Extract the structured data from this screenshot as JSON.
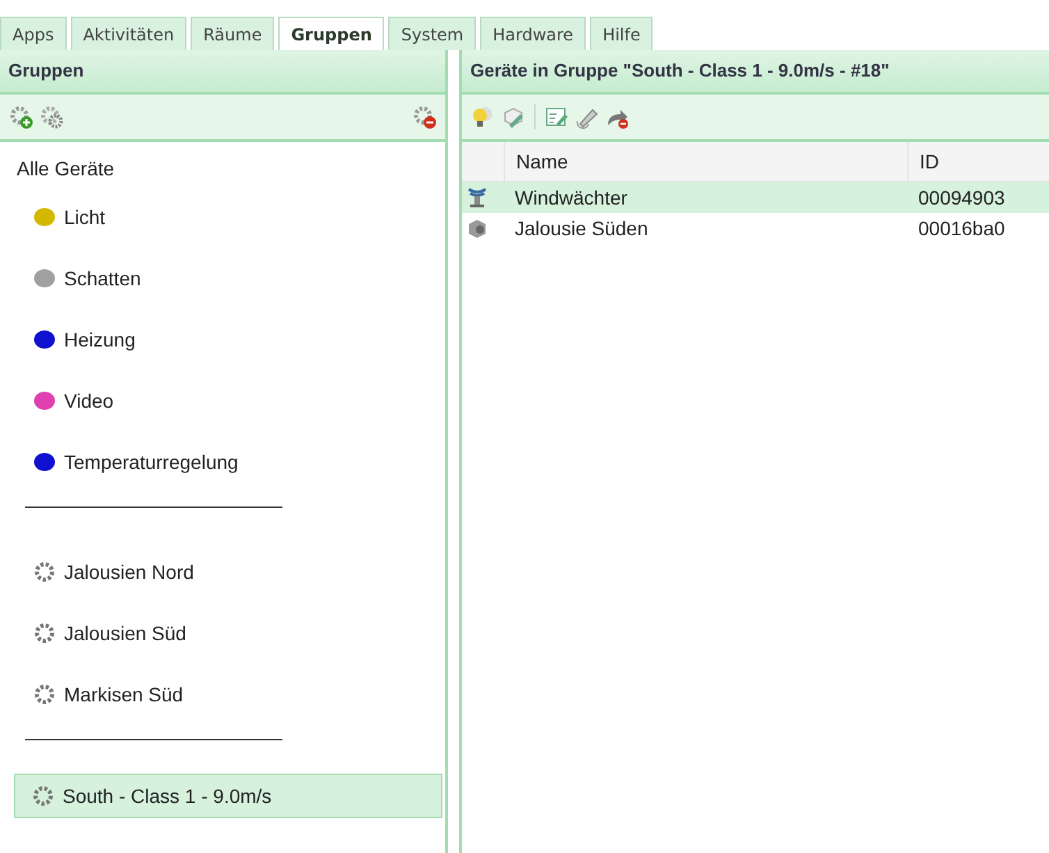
{
  "tabs": [
    {
      "label": "Apps",
      "selected": false
    },
    {
      "label": "Aktivitäten",
      "selected": false
    },
    {
      "label": "Räume",
      "selected": false
    },
    {
      "label": "Gruppen",
      "selected": true
    },
    {
      "label": "System",
      "selected": false
    },
    {
      "label": "Hardware",
      "selected": false
    },
    {
      "label": "Hilfe",
      "selected": false
    }
  ],
  "groups_panel": {
    "title": "Gruppen",
    "items": [
      {
        "kind": "all",
        "label": "Alle Geräte",
        "selected": false
      },
      {
        "kind": "color",
        "label": "Licht",
        "color": "#d4b800",
        "selected": false
      },
      {
        "kind": "color",
        "label": "Schatten",
        "color": "#a0a0a0",
        "selected": false
      },
      {
        "kind": "color",
        "label": "Heizung",
        "color": "#1010d0",
        "selected": false
      },
      {
        "kind": "color",
        "label": "Video",
        "color": "#e040b0",
        "selected": false
      },
      {
        "kind": "color",
        "label": "Temperaturregelung",
        "color": "#1010d0",
        "selected": false
      },
      {
        "kind": "separator"
      },
      {
        "kind": "gear",
        "label": "Jalousien Nord",
        "selected": false
      },
      {
        "kind": "gear",
        "label": "Jalousien Süd",
        "selected": false
      },
      {
        "kind": "gear",
        "label": "Markisen Süd",
        "selected": false
      },
      {
        "kind": "separator"
      },
      {
        "kind": "gear",
        "label": "South - Class 1 - 9.0m/s",
        "selected": true
      }
    ]
  },
  "devices_panel": {
    "title": "Geräte in Gruppe \"South - Class 1 - 9.0m/s - #18\"",
    "columns": [
      "Name",
      "ID"
    ],
    "rows": [
      {
        "kind": "sensor",
        "name": "Windwächter",
        "id": "00094903",
        "selected": true
      },
      {
        "kind": "shade",
        "name": "Jalousie Süden",
        "id": "00016ba0",
        "selected": false
      }
    ]
  }
}
